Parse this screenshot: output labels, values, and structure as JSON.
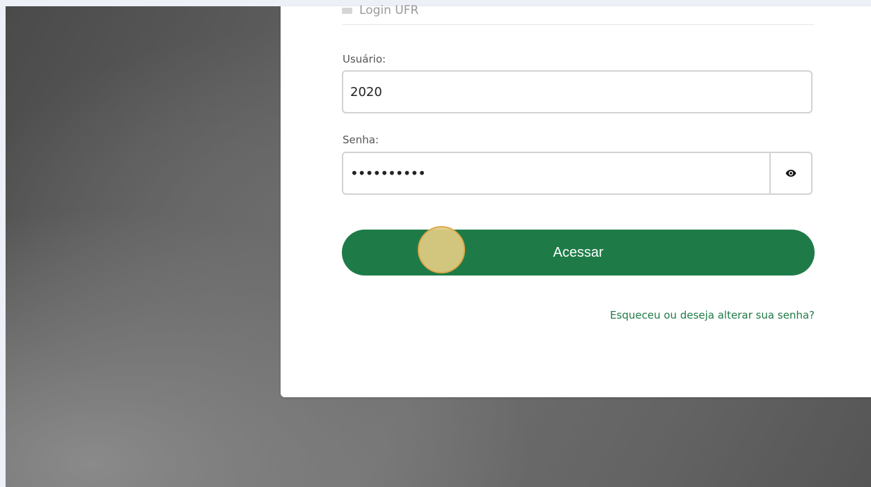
{
  "login_option": {
    "label": "Login UFR"
  },
  "user_field": {
    "label": "Usuário:",
    "value": "2020"
  },
  "password_field": {
    "label": "Senha:",
    "value": "••••••••••",
    "toggle_icon": "eye-icon"
  },
  "submit": {
    "label": "Acessar"
  },
  "forgot_link": {
    "label": "Esqueceu ou deseja alterar sua senha?"
  },
  "colors": {
    "accent": "#1e7b47",
    "click_marker": "#d8c47a"
  }
}
